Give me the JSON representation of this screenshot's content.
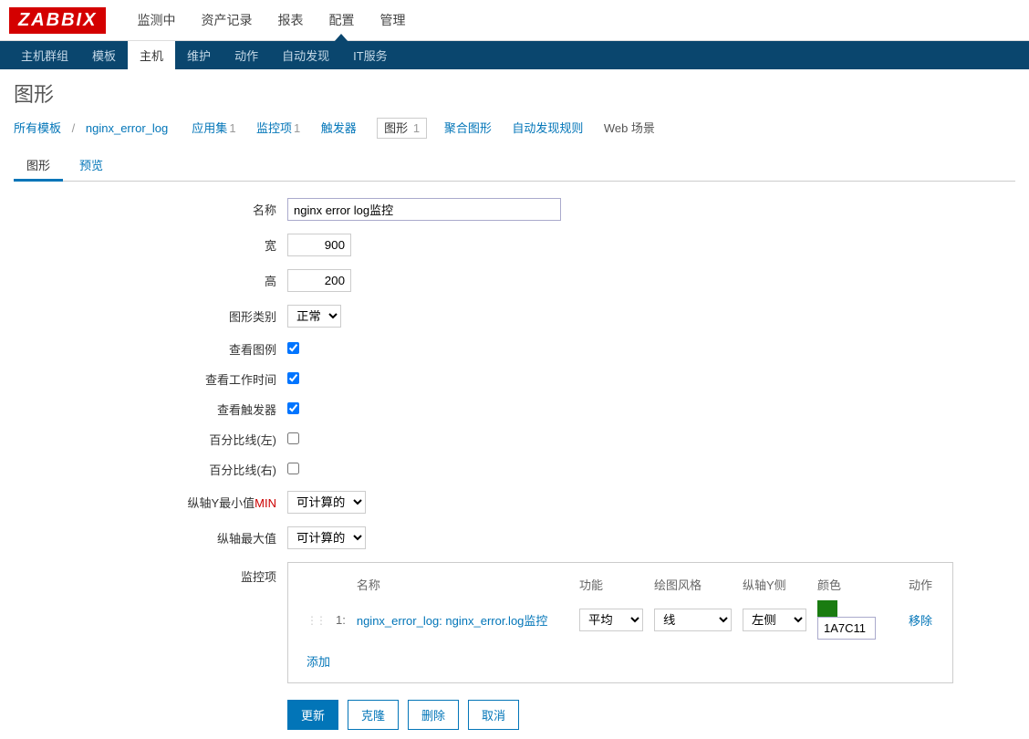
{
  "logo": "ZABBIX",
  "top_nav": {
    "items": [
      "监测中",
      "资产记录",
      "报表",
      "配置",
      "管理"
    ],
    "active_index": 3
  },
  "sub_nav": {
    "items": [
      "主机群组",
      "模板",
      "主机",
      "维护",
      "动作",
      "自动发现",
      "IT服务"
    ],
    "active_index": 2
  },
  "page_title": "图形",
  "breadcrumb": {
    "all_templates": "所有模板",
    "template_name": "nginx_error_log",
    "links": [
      {
        "label": "应用集",
        "count": "1"
      },
      {
        "label": "监控项",
        "count": "1"
      },
      {
        "label": "触发器",
        "count": ""
      }
    ],
    "current": {
      "label": "图形",
      "count": "1"
    },
    "after": [
      {
        "label": "聚合图形",
        "count": ""
      },
      {
        "label": "自动发现规则",
        "count": ""
      }
    ],
    "web": "Web 场景"
  },
  "tabs": {
    "items": [
      "图形",
      "预览"
    ],
    "active_index": 0
  },
  "form": {
    "name": {
      "label": "名称",
      "value": "nginx error log监控"
    },
    "width": {
      "label": "宽",
      "value": "900"
    },
    "height": {
      "label": "高",
      "value": "200"
    },
    "graph_type": {
      "label": "图形类别",
      "value": "正常"
    },
    "show_legend": {
      "label": "查看图例",
      "checked": true
    },
    "show_working_time": {
      "label": "查看工作时间",
      "checked": true
    },
    "show_triggers": {
      "label": "查看触发器",
      "checked": true
    },
    "percent_left": {
      "label": "百分比线(左)",
      "checked": false
    },
    "percent_right": {
      "label": "百分比线(右)",
      "checked": false
    },
    "yaxis_min": {
      "label": "纵轴Y最小值",
      "label_suffix": "MIN",
      "value": "可计算的"
    },
    "yaxis_max": {
      "label": "纵轴最大值",
      "value": "可计算的"
    },
    "items": {
      "label": "监控项",
      "headers": {
        "name": "名称",
        "func": "功能",
        "draw": "绘图风格",
        "yaxis": "纵轴Y侧",
        "color": "颜色",
        "action": "动作"
      },
      "rows": [
        {
          "idx": "1:",
          "name": "nginx_error_log: nginx_error.log监控",
          "func": "平均",
          "draw": "线",
          "yaxis": "左侧",
          "color_hex": "1A7C11",
          "color_style": "#1A7C11",
          "remove": "移除"
        }
      ],
      "add": "添加"
    }
  },
  "buttons": {
    "update": "更新",
    "clone": "克隆",
    "delete": "删除",
    "cancel": "取消"
  }
}
